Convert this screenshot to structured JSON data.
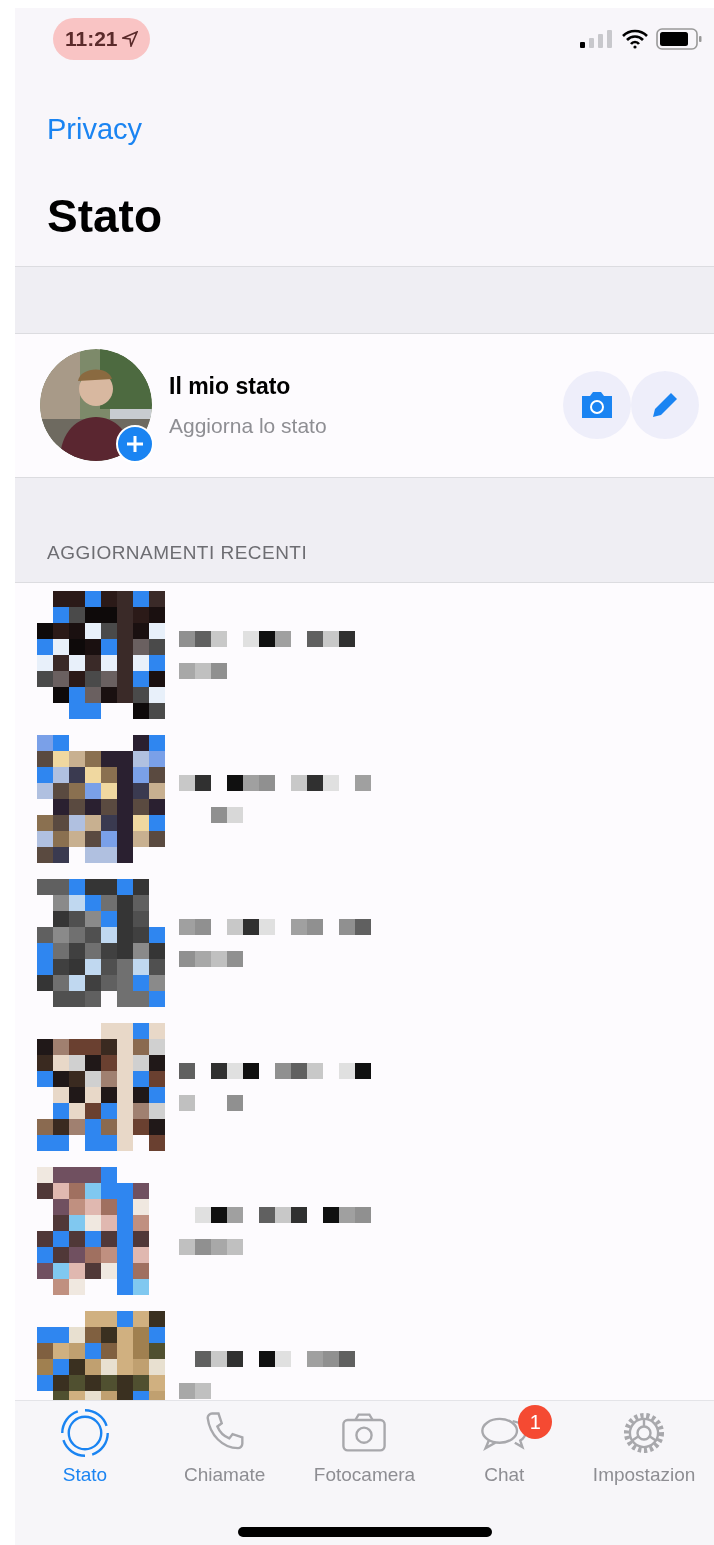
{
  "status_bar": {
    "time": "11:21"
  },
  "nav": {
    "back": "Privacy",
    "title": "Stato"
  },
  "my_status": {
    "title": "Il mio stato",
    "subtitle": "Aggiorna lo stato"
  },
  "section_header": "AGGIORNAMENTI RECENTI",
  "tabs": [
    {
      "label": "Stato",
      "selected": true,
      "kind": "status"
    },
    {
      "label": "Chiamate",
      "selected": false,
      "kind": "phone"
    },
    {
      "label": "Fotocamera",
      "selected": false,
      "kind": "camera"
    },
    {
      "label": "Chat",
      "selected": false,
      "kind": "chat",
      "badge": "1"
    },
    {
      "label": "Impostazion",
      "selected": false,
      "kind": "gear"
    }
  ]
}
